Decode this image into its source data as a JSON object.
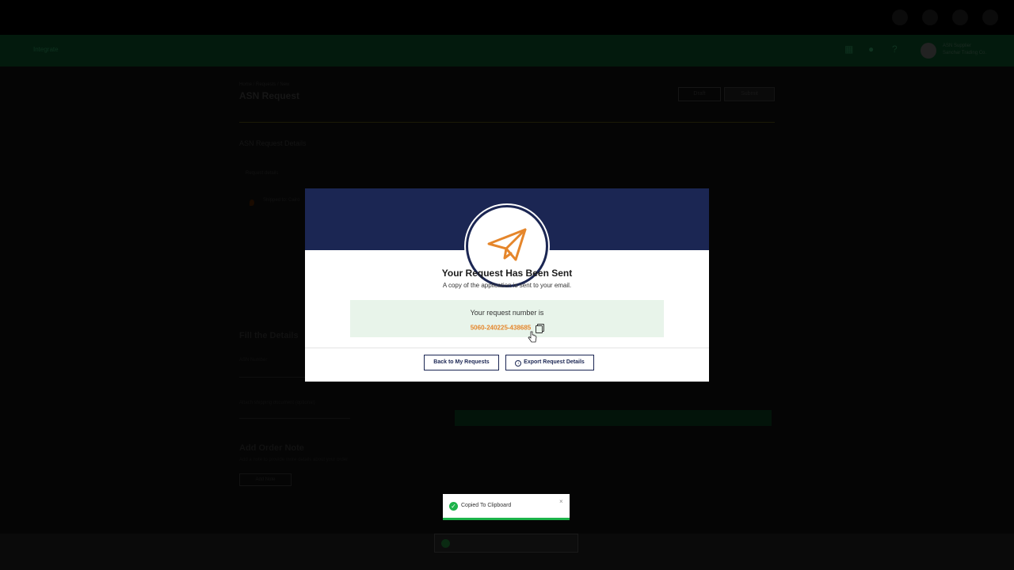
{
  "header": {
    "logo": "Integrate",
    "user_name": "ASN Supplier",
    "user_company": "Sanchar Trading Co."
  },
  "page": {
    "breadcrumb": "Home / Requests / New",
    "title": "ASN Request",
    "draft_label": "Draft",
    "submit_label": "Submit",
    "section_title": "ASN Request Details",
    "sub_label": "Request details",
    "location_text": "Shipped to: Cairo",
    "fill_title": "Fill the Details",
    "field1_label": "ASN Number",
    "field2_label": "Attach shipping document (optional)",
    "order_note_title": "Add Order Note",
    "order_note_sub": "Add a note to provide more details about your order",
    "add_note_label": "Add Note"
  },
  "modal": {
    "title": "Your Request Has Been Sent",
    "subtitle": "A copy of the application is sent to your email.",
    "request_label": "Your request number is",
    "request_number": "5060-240225-438685",
    "back_button": "Back to My Requests",
    "export_button": "Export Request Details"
  },
  "toast": {
    "message": "Copied To Clipboard",
    "close": "×"
  },
  "colors": {
    "modal_header": "#1b2653",
    "accent_orange": "#e5862b",
    "success_green": "#1db34a",
    "request_box_bg": "#e8f4ea"
  },
  "icons": [
    "paper-plane-icon",
    "copy-icon",
    "export-icon",
    "check-icon",
    "close-icon",
    "cursor-hand-icon"
  ]
}
